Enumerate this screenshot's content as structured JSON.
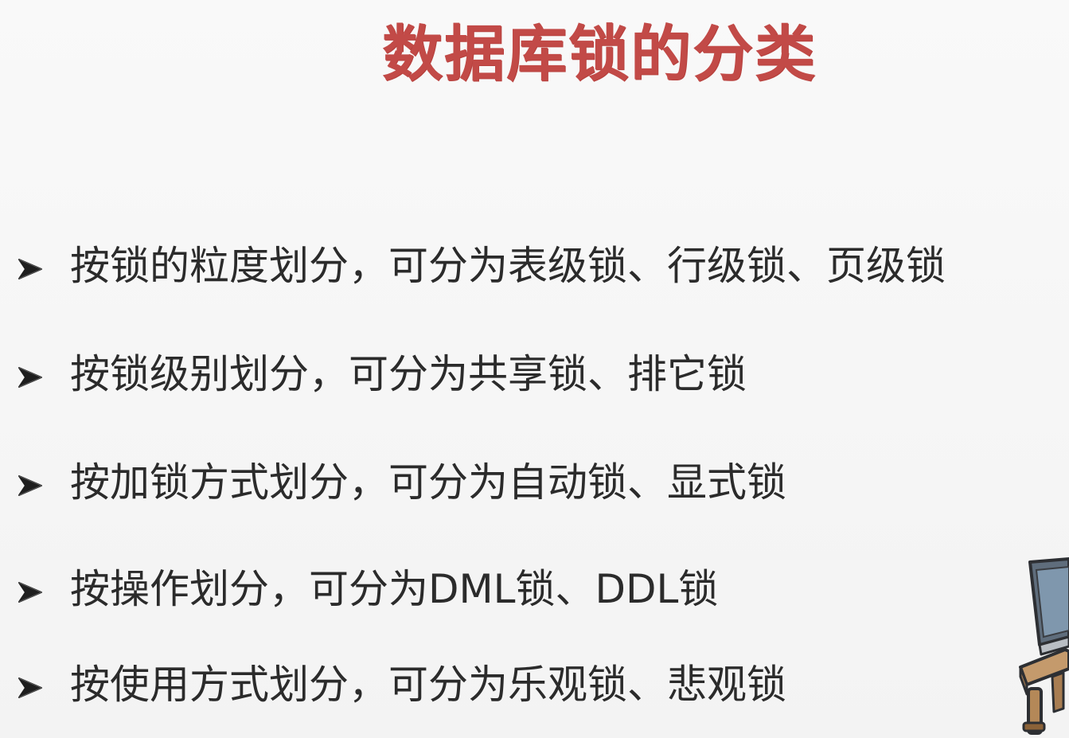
{
  "slide": {
    "title": "数据库锁的分类",
    "bullets": [
      {
        "icon": "arrow-right-icon",
        "text": "按锁的粒度划分，可分为表级锁、行级锁、页级锁"
      },
      {
        "icon": "arrow-right-icon",
        "text": "按锁级别划分，可分为共享锁、排它锁"
      },
      {
        "icon": "arrow-right-icon",
        "text": "按加锁方式划分，可分为自动锁、显式锁"
      },
      {
        "icon": "arrow-right-icon",
        "text": "按操作划分，可分为DML锁、DDL锁"
      },
      {
        "icon": "arrow-right-icon",
        "text": "按使用方式划分，可分为乐观锁、悲观锁"
      }
    ]
  },
  "colors": {
    "title": "#c24a47",
    "text": "#2b2b2b",
    "background": "#f7f7f7"
  }
}
